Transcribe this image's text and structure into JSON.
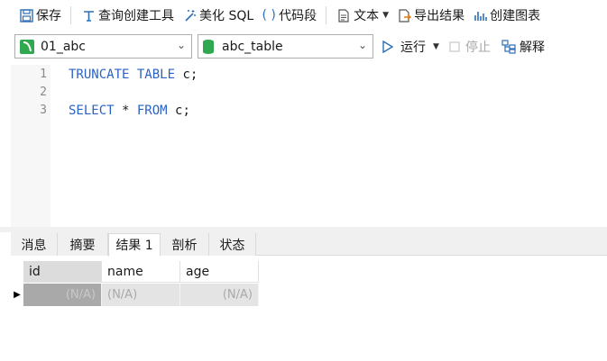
{
  "toolbar": {
    "save_label": "保存",
    "query_builder_label": "查询创建工具",
    "beautify_label": "美化 SQL",
    "snippet_label": "代码段",
    "text_label": "文本",
    "export_label": "导出结果",
    "create_chart_label": "创建图表"
  },
  "connection": {
    "selected": "01_abc"
  },
  "database": {
    "selected": "abc_table"
  },
  "actions": {
    "run_label": "运行",
    "stop_label": "停止",
    "explain_label": "解释"
  },
  "editor": {
    "lines": [
      {
        "num": "1",
        "kw1": "TRUNCATE TABLE",
        "rest": " c;"
      },
      {
        "num": "2"
      },
      {
        "num": "3",
        "kw1": "SELECT",
        "mid": " * ",
        "kw2": "FROM",
        "rest": " c;"
      }
    ]
  },
  "result_tabs": [
    "消息",
    "摘要",
    "结果 1",
    "剖析",
    "状态"
  ],
  "active_tab_index": 2,
  "grid": {
    "columns": [
      "id",
      "name",
      "age"
    ],
    "rows": [
      [
        "(N/A)",
        "(N/A)",
        "(N/A)"
      ]
    ]
  }
}
